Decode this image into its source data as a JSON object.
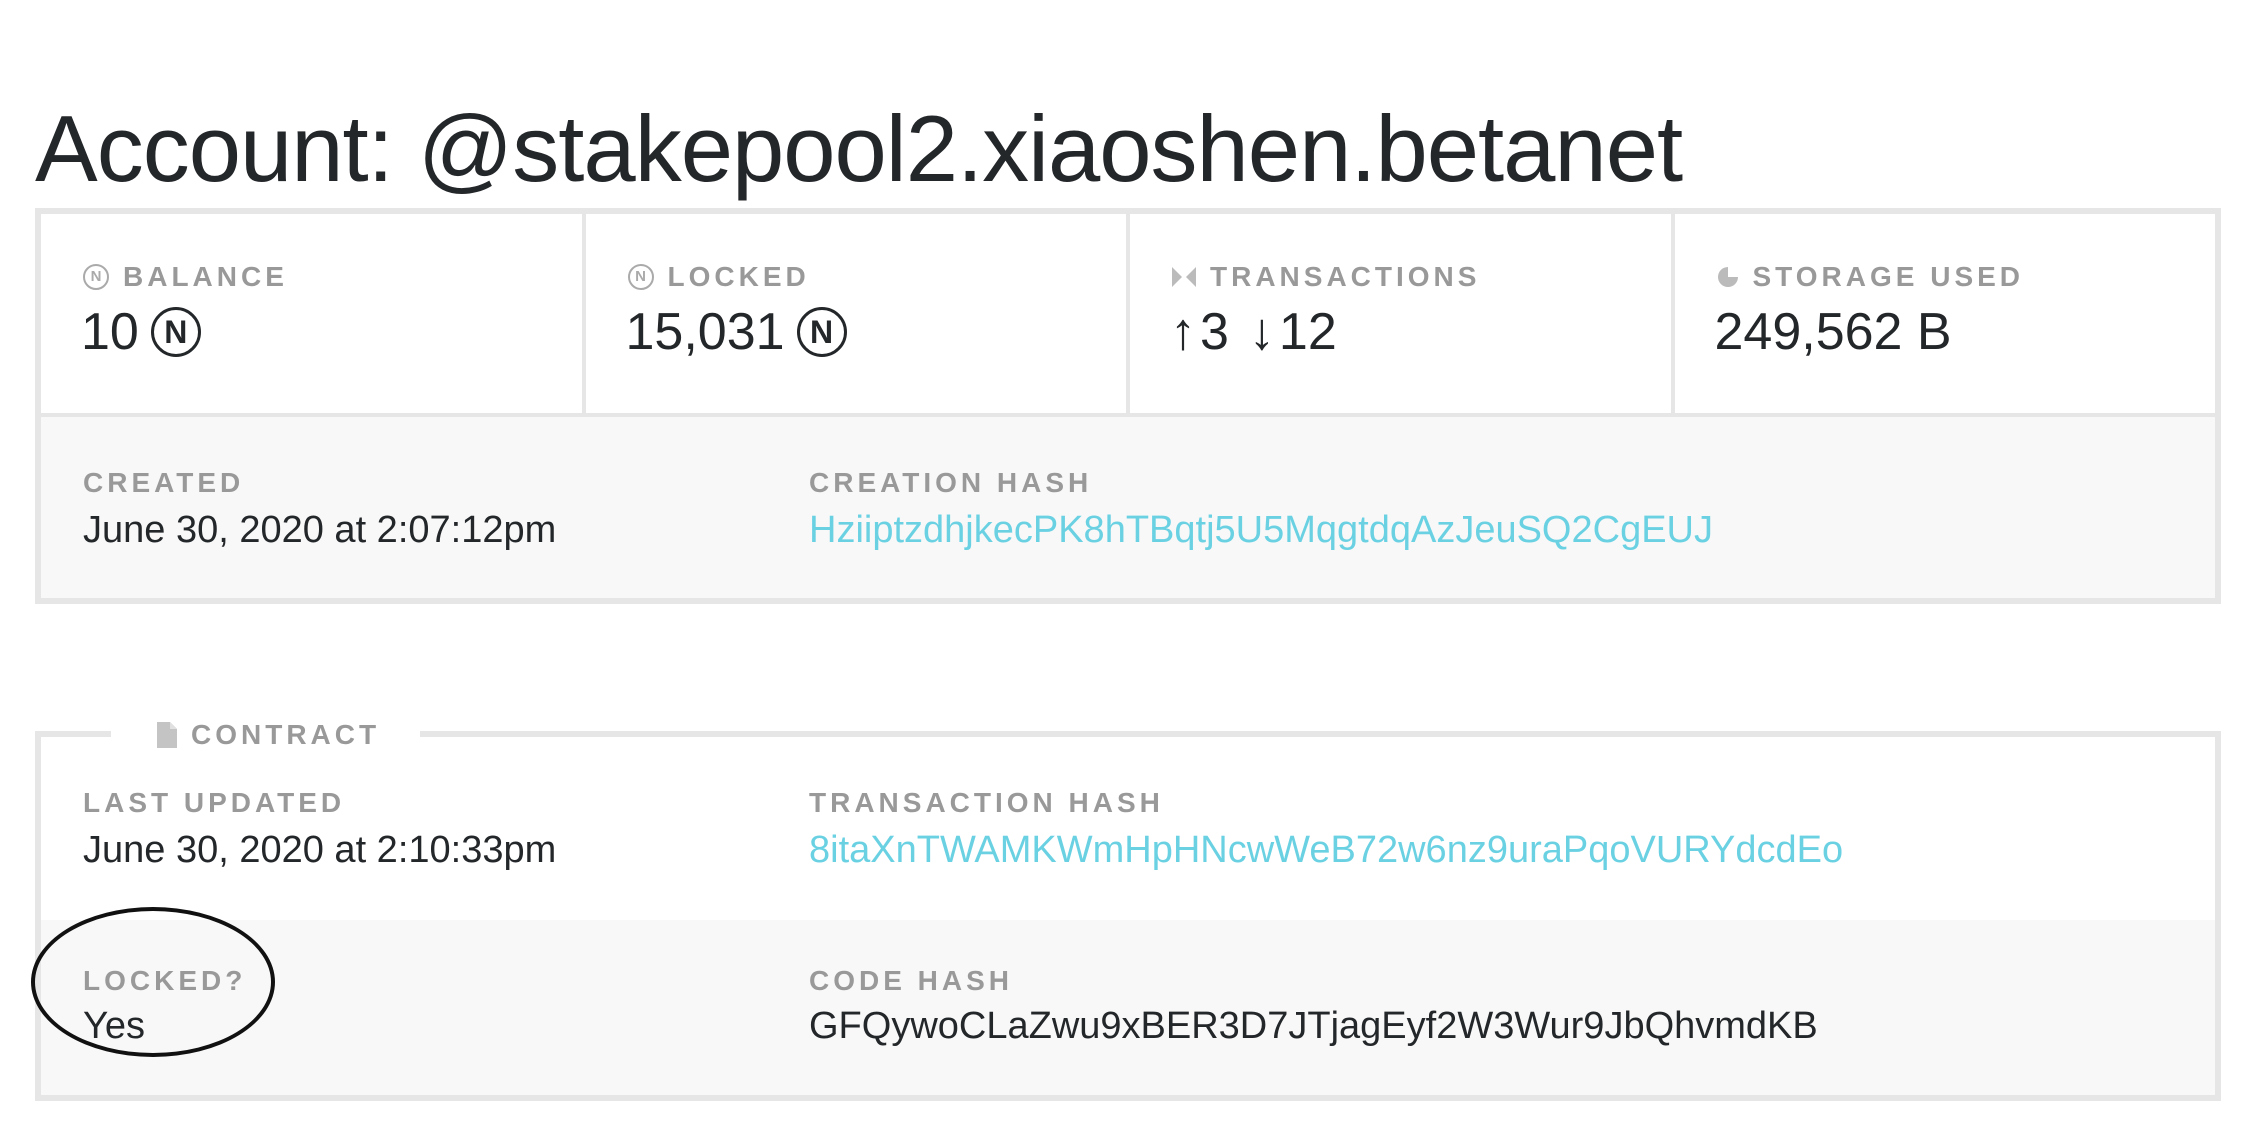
{
  "page": {
    "title": "Account: @stakepool2.xiaoshen.betanet"
  },
  "account": {
    "stats": [
      {
        "icon": "near-icon",
        "label": "BALANCE",
        "value": "10",
        "unit": "Ⓝ"
      },
      {
        "icon": "near-icon",
        "label": "LOCKED",
        "value": "15,031",
        "unit": "Ⓝ"
      },
      {
        "icon": "transactions-icon",
        "label": "TRANSACTIONS",
        "outgoing": "3",
        "incoming": "12",
        "up_arrow": "↑",
        "down_arrow": "↓"
      },
      {
        "icon": "storage-icon",
        "label": "STORAGE USED",
        "value": "249,562 B"
      }
    ],
    "created_label": "CREATED",
    "created_value": "June 30, 2020 at 2:07:12pm",
    "creation_hash_label": "CREATION HASH",
    "creation_hash_value": "HziiptzdhjkecPK8hTBqtj5U5MqgtdqAzJeuSQ2CgEUJ"
  },
  "contract": {
    "legend": "CONTRACT",
    "last_updated_label": "LAST UPDATED",
    "last_updated_value": "June 30, 2020 at 2:10:33pm",
    "transaction_hash_label": "TRANSACTION HASH",
    "transaction_hash_value": "8itaXnTWAMKWmHpHNcwWeB72w6nz9uraPqoVURYdcdEo",
    "locked_label": "LOCKED?",
    "locked_value": "Yes",
    "code_hash_label": "CODE HASH",
    "code_hash_value": "GFQywoCLaZwu9xBER3D7JTjagEyf2W3Wur9JbQhvmdKB"
  },
  "colors": {
    "link": "#6ad1e3",
    "label": "#999999",
    "text": "#24272a",
    "border": "#e6e6e6",
    "row_bg": "#f8f8f8"
  }
}
